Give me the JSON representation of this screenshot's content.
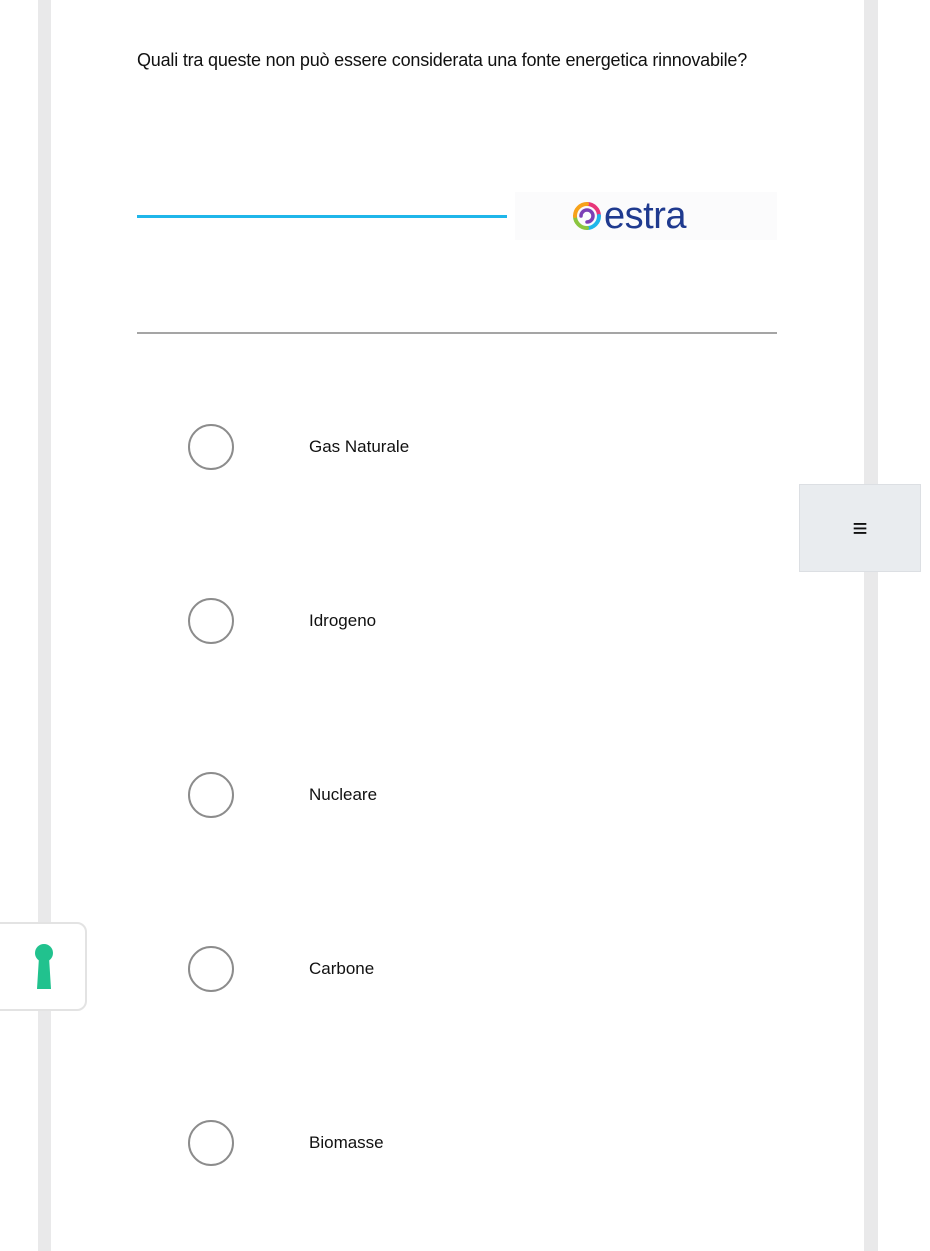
{
  "question": {
    "text": "Quali tra queste non può essere considerata una fonte energetica rinnovabile?"
  },
  "banner": {
    "logo_text": "estra",
    "logo_icon": "estra-swirl-logo",
    "accent_color": "#1fb6ea",
    "logo_text_color": "#1f3a8f"
  },
  "options": [
    {
      "label": "Gas Naturale",
      "selected": false
    },
    {
      "label": "Idrogeno",
      "selected": false
    },
    {
      "label": "Nucleare",
      "selected": false
    },
    {
      "label": "Carbone",
      "selected": false
    },
    {
      "label": "Biomasse",
      "selected": false
    }
  ],
  "menu_button": {
    "glyph": "≡",
    "icon": "menu-icon"
  },
  "side_tab": {
    "icon": "keyhole-icon",
    "color": "#21c28e"
  }
}
